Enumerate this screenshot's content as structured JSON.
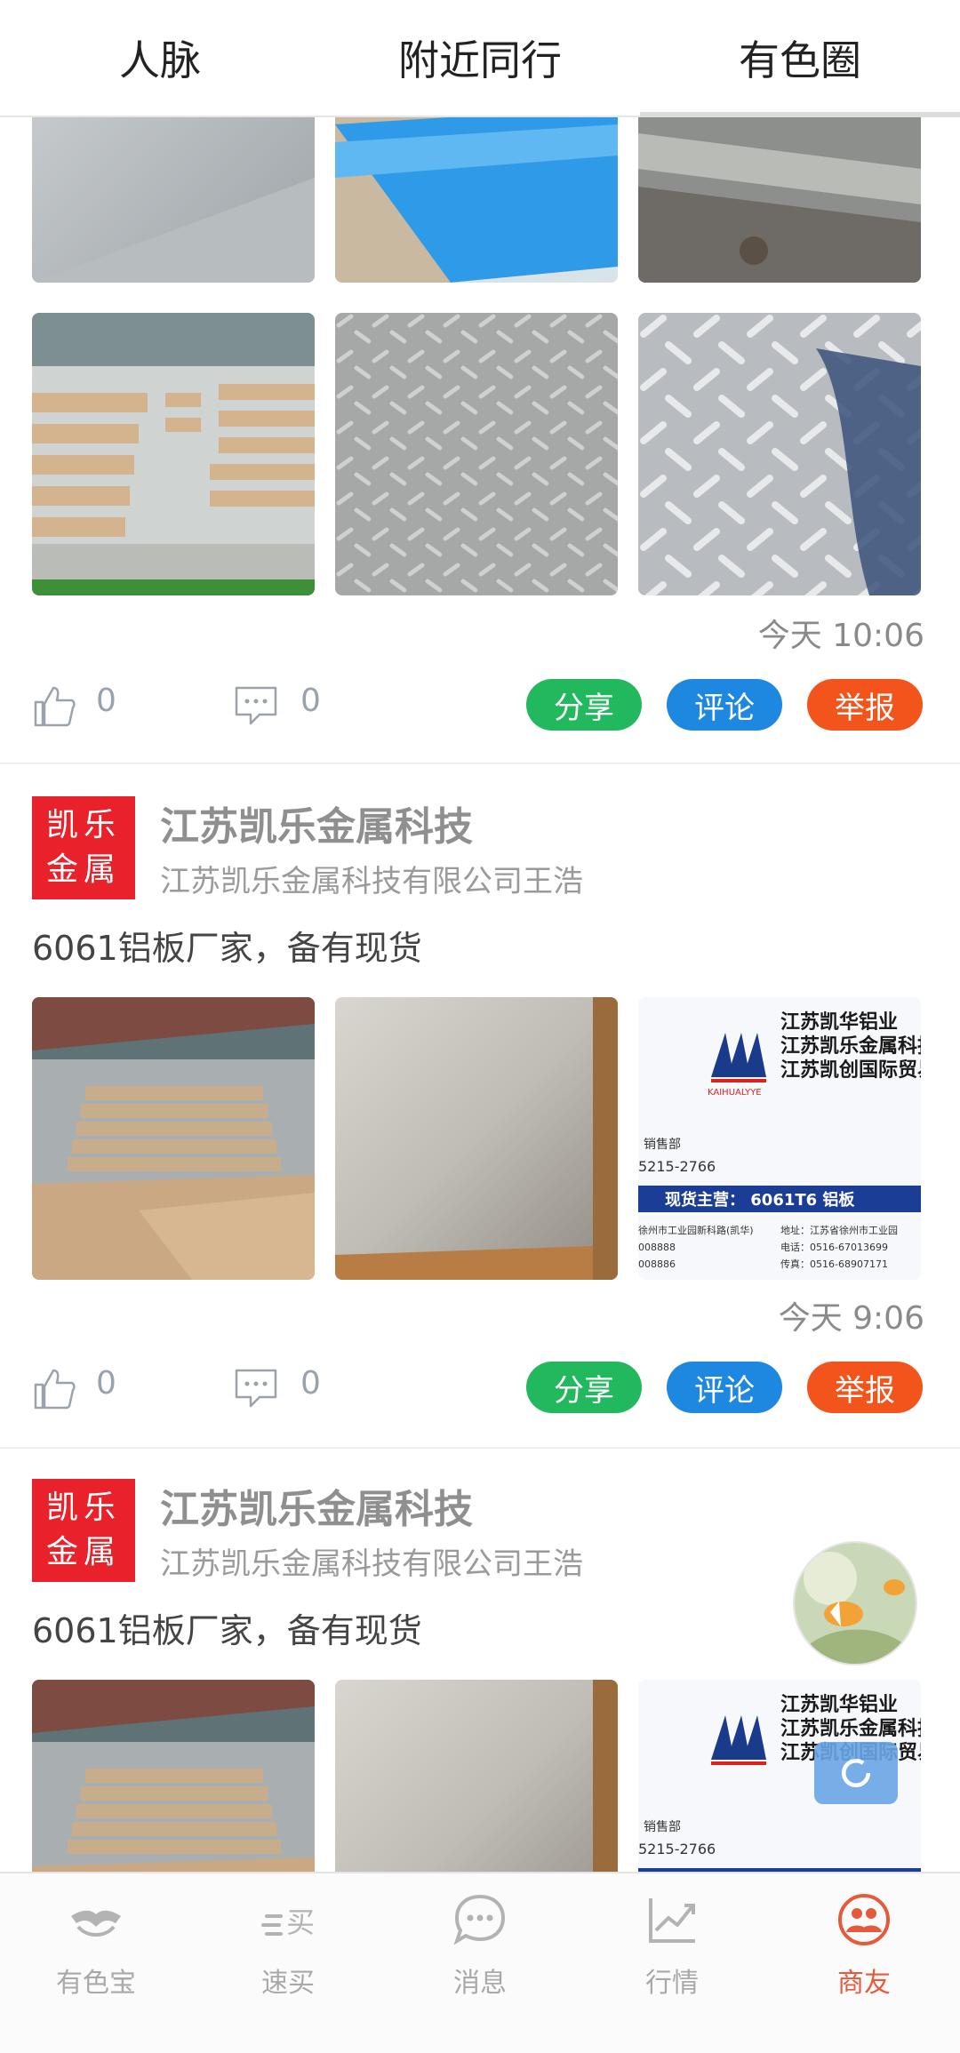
{
  "colors": {
    "share": "#21b85e",
    "comment": "#1e87e0",
    "report": "#f2541b",
    "logo_red": "#e8212a",
    "nav_active": "#e65a3c"
  },
  "tabs": [
    "人脉",
    "附近同行",
    "有色圈"
  ],
  "active_tab": "有色圈",
  "post0": {
    "time": "今天 10:06",
    "likes": "0",
    "comments": "0"
  },
  "post1": {
    "logo_text_line1": "凯乐",
    "logo_text_line2": "金属",
    "company": "江苏凯乐金属科技",
    "subtitle": "江苏凯乐金属科技有限公司王浩",
    "text": "6061铝板厂家，备有现货",
    "time": "今天 9:06",
    "likes": "0",
    "comments": "0"
  },
  "post2": {
    "logo_text_line1": "凯乐",
    "logo_text_line2": "金属",
    "company": "江苏凯乐金属科技",
    "subtitle": "江苏凯乐金属科技有限公司王浩",
    "text": "6061铝板厂家，备有现货"
  },
  "buttons": {
    "share": "分享",
    "comment": "评论",
    "report": "举报"
  },
  "card_image_text": {
    "line1": "江苏凯华铝业",
    "line2": "江苏凯乐金属科技",
    "line3": "江苏凯创国际贸易",
    "brand": "KAIHUALYYE",
    "dept": "销售部",
    "phone_frag": "5215-2766",
    "banner": "现货主营： 6061T6 铝板",
    "addr_left": "徐州市工业园新科路(凯华)",
    "addr_right": "地址：江苏省徐州市工业园",
    "tel_right": "电话：0516-67013699",
    "fax_right": "传真：0516-68907171",
    "num1": "008888",
    "num2": "008886"
  },
  "bottom_nav": [
    {
      "label": "有色宝",
      "icon": "handshake-icon"
    },
    {
      "label": "速买",
      "icon": "quick-buy-icon"
    },
    {
      "label": "消息",
      "icon": "message-bubble-icon"
    },
    {
      "label": "行情",
      "icon": "trend-chart-icon"
    },
    {
      "label": "商友",
      "icon": "friends-icon"
    }
  ],
  "active_nav": "商友"
}
